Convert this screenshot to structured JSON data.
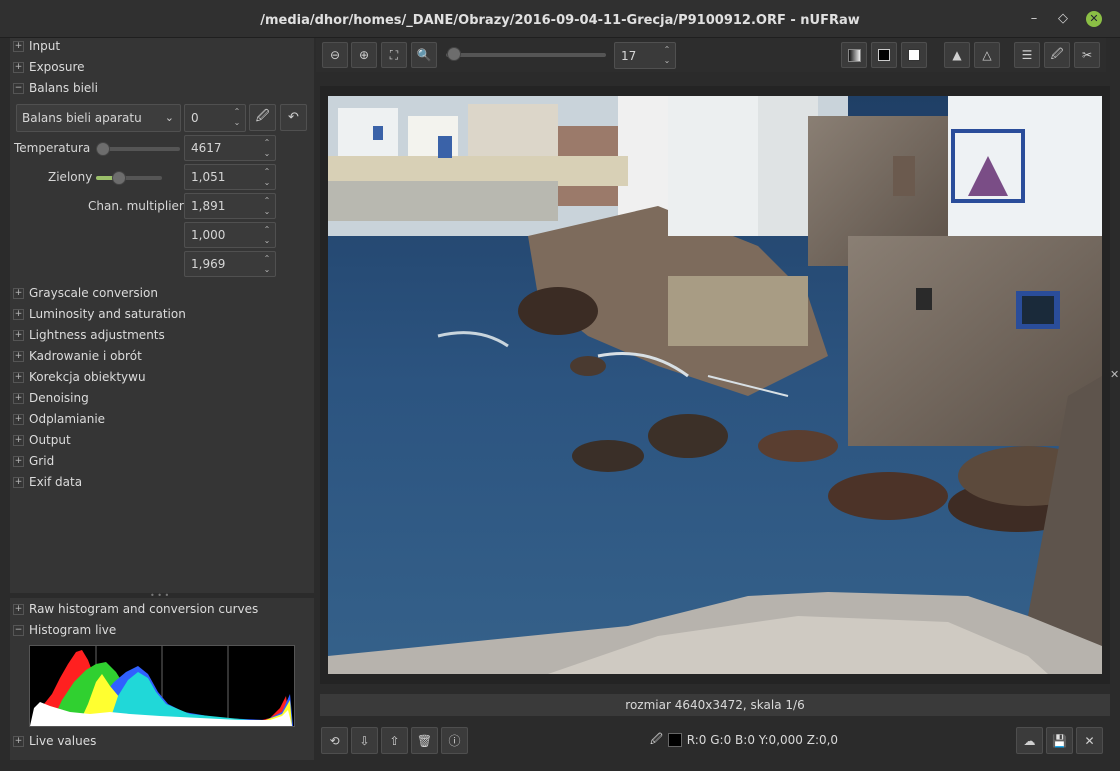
{
  "window": {
    "title": "/media/dhor/homes/_DANE/Obrazy/2016-09-04-11-Grecja/P9100912.ORF - nUFRaw",
    "minimize": "–",
    "maximize": "◇",
    "close": "✕"
  },
  "sections": [
    {
      "label": "Input",
      "sign": "+"
    },
    {
      "label": "Exposure",
      "sign": "+"
    },
    {
      "label": "Balans bieli",
      "sign": "−"
    }
  ],
  "white_balance": {
    "mode": "Balans bieli aparatu",
    "fine_tune": "0",
    "temperature_label": "Temperatura",
    "temperature": "4617",
    "temperature_level": 0.05,
    "green_label": "Zielony",
    "green": "1,051",
    "green_level": 0.35,
    "multipliers_label": "Chan. multipliers",
    "multipliers": [
      "1,891",
      "1,000",
      "1,969"
    ]
  },
  "sections_more": [
    {
      "label": "Grayscale conversion",
      "sign": "+"
    },
    {
      "label": "Luminosity and saturation",
      "sign": "+"
    },
    {
      "label": "Lightness adjustments",
      "sign": "+"
    },
    {
      "label": "Kadrowanie i obrót",
      "sign": "+"
    },
    {
      "label": "Korekcja obiektywu",
      "sign": "+"
    },
    {
      "label": "Denoising",
      "sign": "+"
    },
    {
      "label": "Odplamianie",
      "sign": "+"
    },
    {
      "label": "Output",
      "sign": "+"
    },
    {
      "label": "Grid",
      "sign": "+"
    },
    {
      "label": "Exif data",
      "sign": "+"
    }
  ],
  "bottom_sections": [
    {
      "label": "Raw histogram and conversion curves",
      "sign": "+"
    },
    {
      "label": "Histogram live",
      "sign": "−"
    },
    {
      "label": "Live values",
      "sign": "+"
    }
  ],
  "zoom": {
    "value": "17",
    "level": 0.02
  },
  "status": "rozmiar 4640x3472, skala 1/6",
  "pixel_info": "R:0 G:0 B:0 Y:0,000 Z:0,0",
  "colors": {
    "accent": "#8bbf45",
    "panel": "#353535",
    "background": "#2b2b2b"
  }
}
